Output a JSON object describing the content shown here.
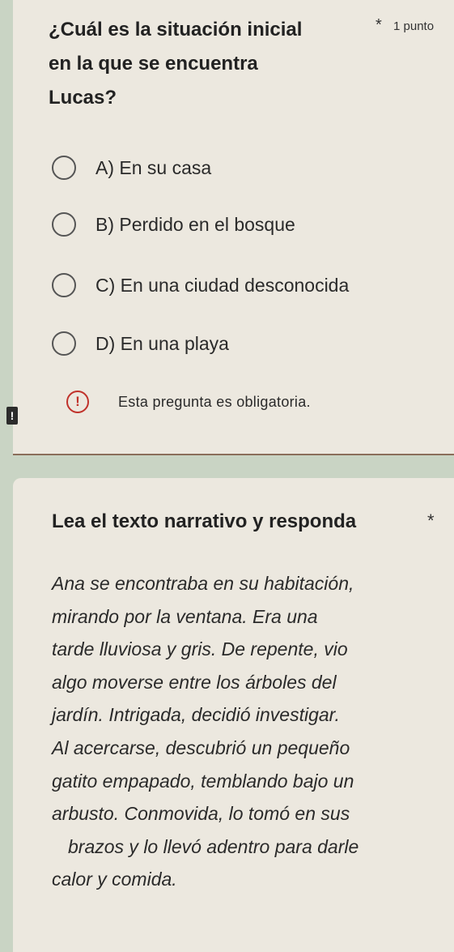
{
  "question1": {
    "title": "¿Cuál es la situación inicial en la que se encuentra Lucas?",
    "required_marker": "*",
    "points": "1 punto",
    "options": [
      {
        "label": "A) En su casa",
        "selected": false
      },
      {
        "label": "B) Perdido en el bosque",
        "selected": false
      },
      {
        "label": "C) En una ciudad desconocida",
        "selected": false
      },
      {
        "label": "D) En una playa",
        "selected": false
      }
    ],
    "required_message": "Esta pregunta es obligatoria.",
    "alert_icon": "!"
  },
  "question2": {
    "title": "Lea el texto narrativo y responda",
    "required_marker": "*",
    "passage_lines": [
      "Ana se encontraba en su habitación,",
      "mirando por la ventana. Era una",
      "tarde lluviosa y gris. De repente, vio",
      "algo moverse entre los árboles del",
      "jardín. Intrigada, decidió investigar.",
      "Al acercarse, descubrió un pequeño",
      "gatito empapado, temblando bajo un",
      "arbusto. Conmovida, lo tomó en sus",
      "brazos y lo llevó adentro para darle",
      "calor y comida."
    ],
    "flag_icon": "!"
  },
  "colors": {
    "card_bg": "#ece8df",
    "page_bg": "#c9d4c4",
    "error": "#c0322b",
    "divider": "#8a6e5a"
  }
}
